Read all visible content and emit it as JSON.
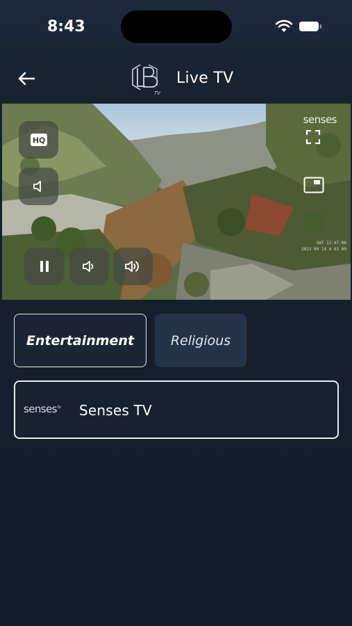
{
  "status_bar": {
    "time": "8:43"
  },
  "header": {
    "title": "Live TV",
    "logo_text": "TV"
  },
  "player": {
    "watermark": "senses",
    "overlay_line1": "SAT 12:47:06",
    "overlay_line2": "2023 09 14 A 03 09",
    "controls": {
      "hq_label": "HQ"
    }
  },
  "tabs": [
    {
      "label": "Entertainment",
      "selected": true
    },
    {
      "label": "Religious",
      "selected": false
    }
  ],
  "channels": [
    {
      "logo_text": "senses",
      "logo_suffix": "tv",
      "name": "Senses TV"
    }
  ],
  "colors": {
    "background": "#151e2c",
    "tab_inactive": "#24324a",
    "border_active": "#e6e9ee"
  }
}
